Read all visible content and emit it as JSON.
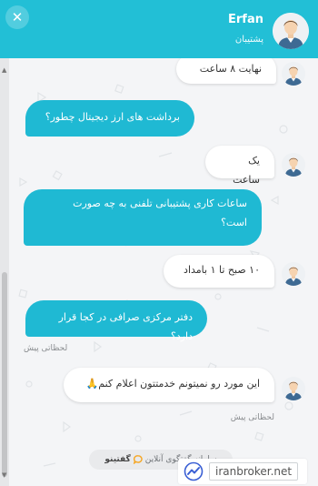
{
  "header": {
    "close_label": "✕",
    "agent_name": "Erfan",
    "agent_role": "پشتیبان"
  },
  "messages": [
    {
      "sender": "agent",
      "text": "نهایت ۸ ساعت"
    },
    {
      "sender": "user",
      "text": "برداشت های ارز دیجیتال چطور؟"
    },
    {
      "sender": "agent",
      "text": "یک ساعت"
    },
    {
      "sender": "user",
      "text_line1": "ساعات کاری پشتیبانی تلفنی به چه صورت",
      "text_line2": "است؟"
    },
    {
      "sender": "agent",
      "text": "۱۰ صبح تا ۱ بامداد"
    },
    {
      "sender": "user",
      "text": "دفتر مرکزی صرافی در کجا قرار دارد؟",
      "time": "لحظاتی پیش"
    },
    {
      "sender": "agent",
      "text": "این مورد رو نمیتونم خدمتتون اعلام کنم🙏",
      "time": "لحظاتی پیش"
    }
  ],
  "branding": {
    "prefix": "سامانه گفتگوی آنلاین",
    "brand": "گفتینو",
    "brand_color": "#f5a623"
  },
  "watermark": {
    "text": "iranbroker.net"
  },
  "colors": {
    "header": "#22bfd6",
    "user_bubble": "#1fb9d3",
    "agent_bubble": "#ffffff",
    "chat_bg": "#f4f5f7"
  },
  "scrollbar": {
    "up_icon": "▲",
    "down_icon": "▼"
  }
}
